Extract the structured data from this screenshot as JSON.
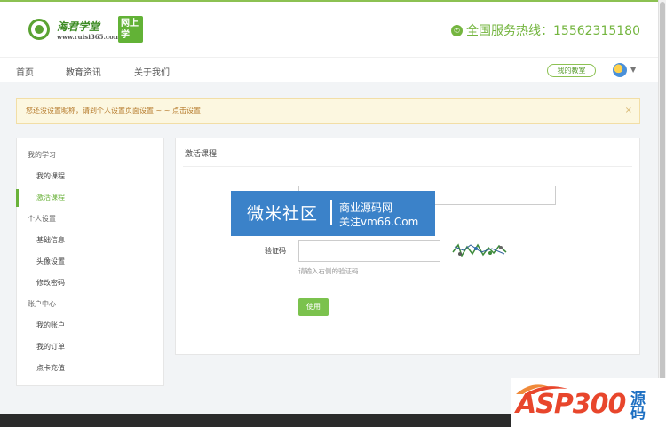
{
  "header": {
    "logo_name": "海君学堂",
    "logo_url": "www.ruisi365.com",
    "logo_badge": "网上学",
    "hotline": "全国服务热线：15562315180"
  },
  "nav": {
    "items": [
      "首页",
      "教育资讯",
      "关于我们"
    ],
    "classroom": "我的教室"
  },
  "alert": {
    "text": "您还没设置昵称，请到个人设置页面设置 ~ ~ 点击设置",
    "close": "×"
  },
  "sidebar": {
    "groups": [
      {
        "heading": "我的学习",
        "links": [
          "我的课程",
          "激活课程"
        ]
      },
      {
        "heading": "个人设置",
        "links": [
          "基础信息",
          "头像设置",
          "修改密码"
        ]
      },
      {
        "heading": "账户中心",
        "links": [
          "我的账户",
          "我的订单",
          "点卡充值"
        ]
      }
    ],
    "active": "激活课程"
  },
  "panel": {
    "title": "激活课程",
    "vcode_label": "验证码",
    "vcode_hint": "请输入右侧的验证码",
    "use_button": "使用"
  },
  "watermark": {
    "left": "微米社区",
    "right_line1": "商业源码网",
    "right_line2": "关注vm66.Com"
  },
  "asp_logo": {
    "text": "ASP300",
    "cn": "源码"
  },
  "colors": {
    "brand_green": "#6ab23a",
    "alert_bg": "#fcf7e0",
    "watermark_blue": "#3b82c9"
  }
}
